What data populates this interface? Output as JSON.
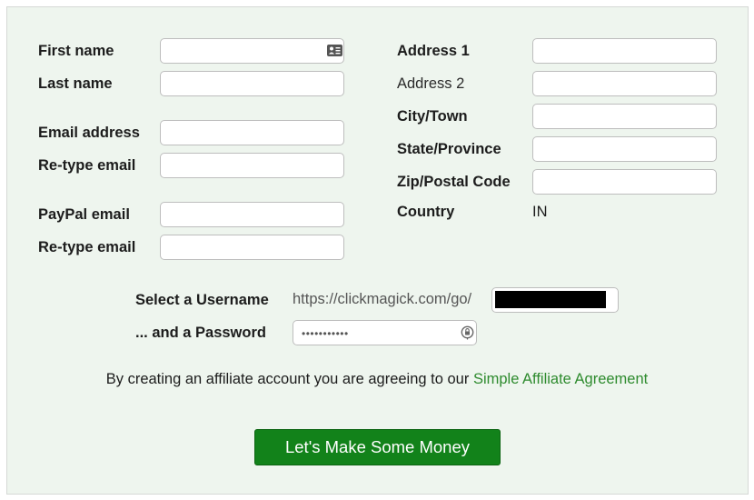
{
  "form": {
    "left": {
      "first_name": {
        "label": "First name",
        "value": "",
        "icon": "contact-card-icon"
      },
      "last_name": {
        "label": "Last name",
        "value": ""
      },
      "email": {
        "label": "Email address",
        "value": ""
      },
      "retype_email": {
        "label": "Re-type email",
        "value": ""
      },
      "paypal_email": {
        "label": "PayPal email",
        "value": ""
      },
      "retype_paypal_email": {
        "label": "Re-type email",
        "value": ""
      }
    },
    "right": {
      "address1": {
        "label": "Address 1",
        "value": ""
      },
      "address2": {
        "label": "Address 2",
        "value": ""
      },
      "city": {
        "label": "City/Town",
        "value": ""
      },
      "state": {
        "label": "State/Province",
        "value": ""
      },
      "zip": {
        "label": "Zip/Postal Code",
        "value": ""
      },
      "country": {
        "label": "Country",
        "value": "IN"
      }
    },
    "username": {
      "label": "Select a Username",
      "url_prefix": "https://clickmagick.com/go/",
      "value_redacted": true
    },
    "password": {
      "label": "... and a Password",
      "masked_value": "•••••••••••",
      "icon": "password-manager-icon"
    },
    "agreement": {
      "text": "By creating an affiliate account you are agreeing to our ",
      "link_text": "Simple Affiliate Agreement"
    },
    "submit_label": "Let's Make Some Money"
  },
  "colors": {
    "panel_bg": "#eef5ee",
    "button_bg": "#12821a",
    "link": "#2e8b2e"
  }
}
